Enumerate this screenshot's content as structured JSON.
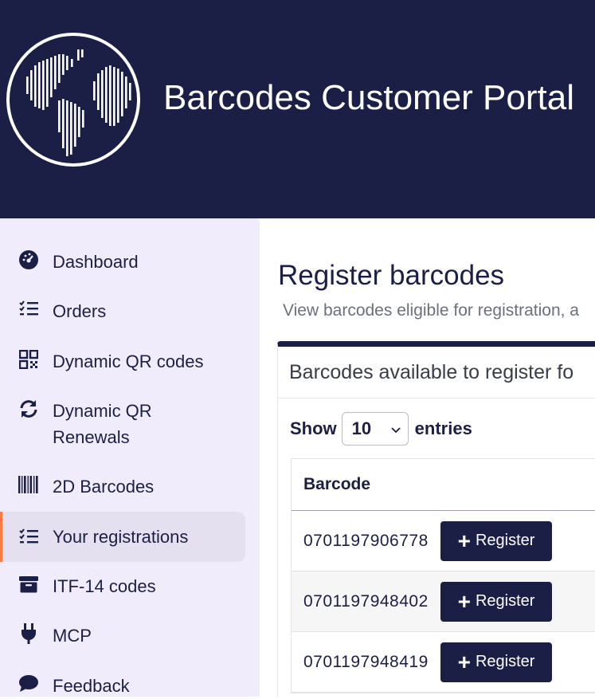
{
  "header": {
    "title": "Barcodes Customer Portal",
    "logo_icon": "globe-barcode-icon",
    "background": "#1c1f45"
  },
  "sidebar": {
    "background": "#f1ecfb",
    "active_accent": "#ff7a45",
    "items": [
      {
        "label": "Dashboard",
        "icon": "dashboard-icon"
      },
      {
        "label": "Orders",
        "icon": "checklist-icon"
      },
      {
        "label": "Dynamic QR codes",
        "icon": "qr-code-icon"
      },
      {
        "label": "Dynamic QR Renewals",
        "icon": "refresh-icon"
      },
      {
        "label": "2D Barcodes",
        "icon": "barcode-icon"
      },
      {
        "label": "Your registrations",
        "icon": "checklist-icon",
        "active": true
      },
      {
        "label": "ITF-14 codes",
        "icon": "box-icon"
      },
      {
        "label": "MCP",
        "icon": "plug-icon"
      },
      {
        "label": "Feedback",
        "icon": "chat-icon"
      }
    ]
  },
  "main": {
    "title": "Register barcodes",
    "subtitle": "View barcodes eligible for registration, a",
    "card": {
      "title": "Barcodes available to register fo",
      "show_label": "Show",
      "entries_value": "10",
      "entries_label": "entries",
      "columns": [
        "Barcode"
      ],
      "rows": [
        {
          "barcode": "0701197906778",
          "action": "Register"
        },
        {
          "barcode": "0701197948402",
          "action": "Register"
        },
        {
          "barcode": "0701197948419",
          "action": "Register"
        }
      ]
    }
  }
}
